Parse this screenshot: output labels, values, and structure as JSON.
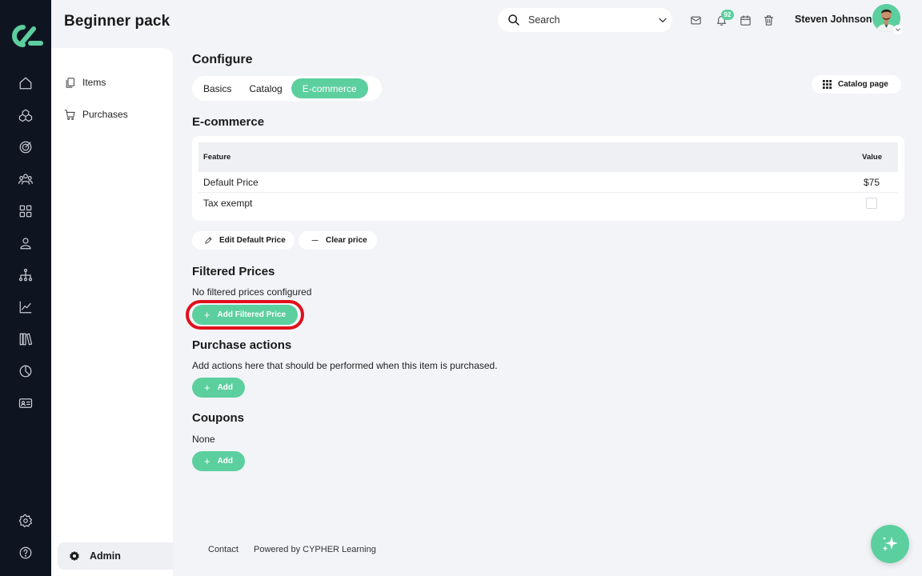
{
  "header": {
    "title": "Beginner pack",
    "search_placeholder": "Search",
    "notification_count": "92",
    "user_name": "Steven Johnson"
  },
  "rail": {
    "icons": [
      "home-icon",
      "courses-icon",
      "target-icon",
      "users-icon",
      "apps-icon",
      "person-icon",
      "org-chart-icon",
      "analytics-icon",
      "library-icon",
      "reports-icon",
      "id-card-icon",
      "settings-icon",
      "help-icon"
    ]
  },
  "subnav": {
    "items": [
      {
        "label": "Items",
        "icon": "copy-icon"
      },
      {
        "label": "Purchases",
        "icon": "cart-icon"
      }
    ],
    "admin_label": "Admin"
  },
  "configure": {
    "title": "Configure",
    "tabs": [
      "Basics",
      "Catalog",
      "E-commerce"
    ],
    "active_tab": "E-commerce",
    "catalog_page_label": "Catalog page"
  },
  "ecommerce": {
    "title": "E-commerce",
    "columns": [
      "Feature",
      "Value"
    ],
    "rows": [
      {
        "feature": "Default Price",
        "value": "$75"
      },
      {
        "feature": "Tax exempt",
        "value": ""
      }
    ],
    "edit_label": "Edit Default Price",
    "clear_label": "Clear price"
  },
  "filtered_prices": {
    "title": "Filtered Prices",
    "description": "No filtered prices configured",
    "add_label": "Add Filtered Price"
  },
  "purchase_actions": {
    "title": "Purchase actions",
    "description": "Add actions here that should be performed when this item is purchased.",
    "add_label": "Add"
  },
  "coupons": {
    "title": "Coupons",
    "description": "None",
    "add_label": "Add"
  },
  "footer": {
    "contact": "Contact",
    "powered_by": "Powered by CYPHER Learning"
  },
  "colors": {
    "accent": "#5ccf9f",
    "rail_bg": "#0f1520",
    "highlight": "#e0101b"
  }
}
